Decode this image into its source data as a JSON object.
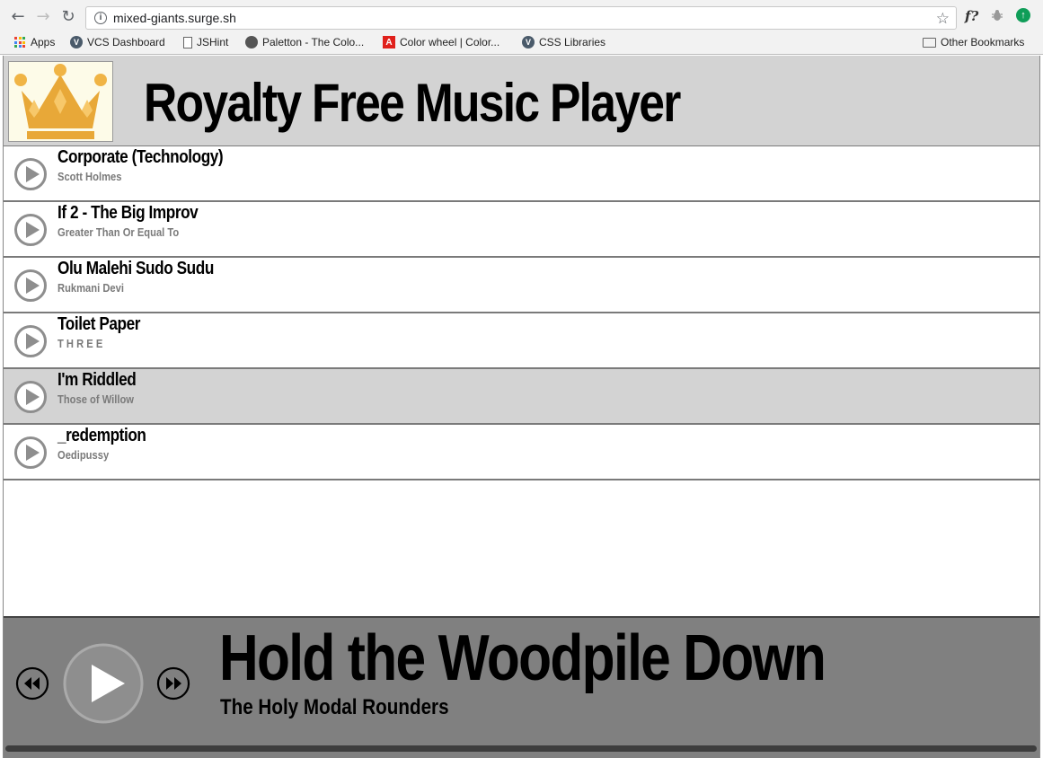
{
  "browser": {
    "url": "mixed-giants.surge.sh",
    "bookmarks": [
      {
        "label": "Apps",
        "icon": "apps-grid-icon"
      },
      {
        "label": "VCS Dashboard",
        "icon": "v-icon"
      },
      {
        "label": "JSHint",
        "icon": "document-icon"
      },
      {
        "label": "Paletton - The Colo...",
        "icon": "paletton-icon"
      },
      {
        "label": "Color wheel | Color...",
        "icon": "adobe-icon"
      },
      {
        "label": "CSS Libraries",
        "icon": "v-icon"
      }
    ],
    "other_bookmarks": "Other Bookmarks",
    "extension_fx": "f?"
  },
  "header": {
    "title": "Royalty Free Music Player",
    "logo": "crown-logo"
  },
  "tracks": [
    {
      "title": "Corporate (Technology)",
      "artist": "Scott Holmes",
      "active": false
    },
    {
      "title": "If 2 - The Big Improv",
      "artist": "Greater Than Or Equal To",
      "active": false
    },
    {
      "title": "Olu Malehi Sudo Sudu",
      "artist": "Rukmani Devi",
      "active": false
    },
    {
      "title": "Toilet Paper",
      "artist": "T H R E E",
      "active": false
    },
    {
      "title": "I'm Riddled",
      "artist": "Those of Willow",
      "active": true
    },
    {
      "title": "_redemption",
      "artist": "Oedipussy",
      "active": false
    }
  ],
  "player": {
    "now_playing_title": "Hold the Woodpile Down",
    "now_playing_artist": "The Holy Modal Rounders",
    "progress": 0
  },
  "colors": {
    "header_bg": "#d3d3d3",
    "player_bg": "#808080",
    "active_row_bg": "#d3d3d3",
    "artist_text": "#7a7a7a",
    "crown_gold": "#e8a838"
  }
}
